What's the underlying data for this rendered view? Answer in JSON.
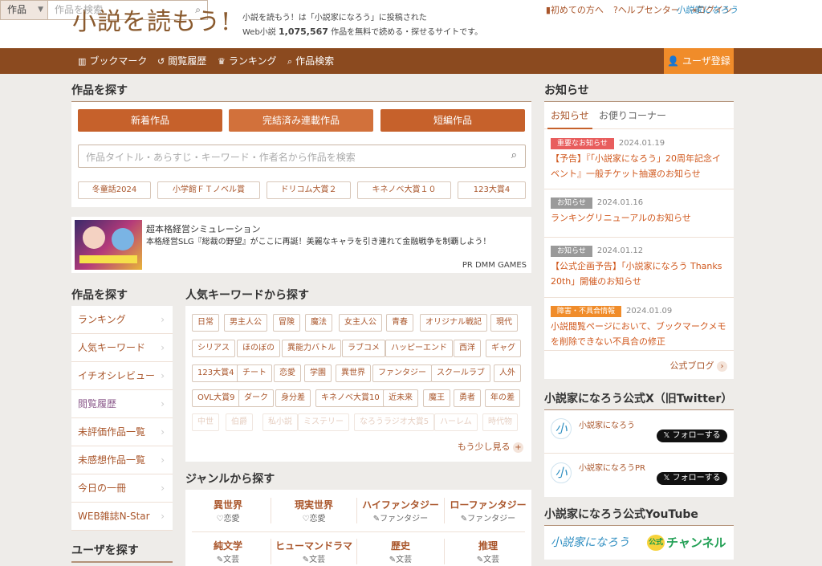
{
  "header": {
    "logo": "小説を読もう!",
    "tagline1": "小説を読もう！は「小説家になろう」に投稿された",
    "tagline2_prefix": "Web小説",
    "tagline2_count": "1,075,567",
    "tagline2_suffix": "作品を無料で読める・探せるサイトです。",
    "links": [
      "初めての方へ",
      "ヘルプセンター",
      "ログイン"
    ],
    "brand_mini": "小説家になろう",
    "search_select": "作品",
    "search_placeholder": "作品を検索"
  },
  "nav": {
    "items": [
      "ブックマーク",
      "閲覧履歴",
      "ランキング",
      "作品検索"
    ],
    "register": "ユーザ登録"
  },
  "find": {
    "title": "作品を探す",
    "buttons": [
      "新着作品",
      "完結済み連載作品",
      "短編作品"
    ],
    "search_placeholder": "作品タイトル・あらすじ・キーワード・作者名から作品を検索",
    "tags": [
      "冬童話2024",
      "小学館ＦＴノベル賞",
      "ドリコム大賞２",
      "キネノベ大賞１０",
      "123大賞4"
    ]
  },
  "ad": {
    "title": "超本格経営シミュレーション",
    "body": "本格経営SLG『総裁の野望』がここに再誕！美麗なキャラを引き連れて金融戦争を制覇しよう！",
    "credit": "PR DMM GAMES"
  },
  "sidebar": {
    "title": "作品を探す",
    "items": [
      "ランキング",
      "人気キーワード",
      "イチオシレビュー",
      "閲覧履歴",
      "未評価作品一覧",
      "未感想作品一覧",
      "今日の一冊",
      "WEB雑誌N-Star"
    ],
    "user_title": "ユーザを探す"
  },
  "keywords": {
    "title": "人気キーワードから探す",
    "rows": [
      [
        "日常",
        "男主人公",
        "冒険",
        "魔法",
        "女主人公",
        "青春",
        "オリジナル戦記",
        "現代"
      ],
      [
        "シリアス",
        "ほのぼの",
        "異能力バトル",
        "ラブコメ",
        "ハッピーエンド",
        "西洋",
        "ギャグ"
      ],
      [
        "123大賞4",
        "チート",
        "恋愛",
        "学園",
        "異世界",
        "ファンタジー",
        "スクールラブ",
        "人外"
      ],
      [
        "OVL大賞9",
        "ダーク",
        "身分差",
        "キネノベ大賞10",
        "近未来",
        "魔王",
        "勇者",
        "年の差"
      ],
      [
        "中世",
        "伯爵",
        "私小説",
        "ミステリー",
        "なろうラジオ大賞5",
        "ハーレム",
        "時代物"
      ]
    ],
    "more": "もう少し見る"
  },
  "genre": {
    "title": "ジャンルから探す",
    "row1": [
      {
        "name": "異世界",
        "sub": "♡恋愛"
      },
      {
        "name": "現実世界",
        "sub": "♡恋愛"
      },
      {
        "name": "ハイファンタジー",
        "sub": "✎ファンタジー"
      },
      {
        "name": "ローファンタジー",
        "sub": "✎ファンタジー"
      }
    ],
    "row2": [
      {
        "name": "純文学",
        "sub": "✎文芸"
      },
      {
        "name": "ヒューマンドラマ",
        "sub": "✎文芸"
      },
      {
        "name": "歴史",
        "sub": "✎文芸"
      },
      {
        "name": "推理",
        "sub": "✎文芸"
      }
    ]
  },
  "notices": {
    "title": "お知らせ",
    "tabs": [
      "お知らせ",
      "お便りコーナー"
    ],
    "items": [
      {
        "badge": "重要なお知らせ",
        "date": "2024.01.19",
        "text": "【予告】『「小説家になろう」20周年記念イベント』一般チケット抽選のお知らせ"
      },
      {
        "badge": "お知らせ",
        "date": "2024.01.16",
        "text": "ランキングリニューアルのお知らせ"
      },
      {
        "badge": "お知らせ",
        "date": "2024.01.12",
        "text": "【公式企画予告】「小説家になろう Thanks 20th」開催のお知らせ"
      },
      {
        "badge": "障害・不具合情報",
        "date": "2024.01.09",
        "text": "小説閲覧ページにおいて、ブックマークメモを削除できない不具合の修正"
      }
    ],
    "blog": "公式ブログ"
  },
  "twitter": {
    "title": "小説家になろう公式X（旧Twitter）",
    "accounts": [
      {
        "name": "小説家になろう",
        "follow": "フォローする"
      },
      {
        "name": "小説家になろうPR",
        "follow": "フォローする"
      }
    ]
  },
  "youtube": {
    "title": "小説家になろう公式YouTube",
    "banner_left": "小説家になろう",
    "banner_mid": "公式",
    "banner_right": "チャンネル"
  },
  "colors": {
    "brand_brown": "#8b4a1f",
    "accent_orange": "#c6612b",
    "register_orange": "#f08c2a",
    "link": "#a9552a"
  }
}
